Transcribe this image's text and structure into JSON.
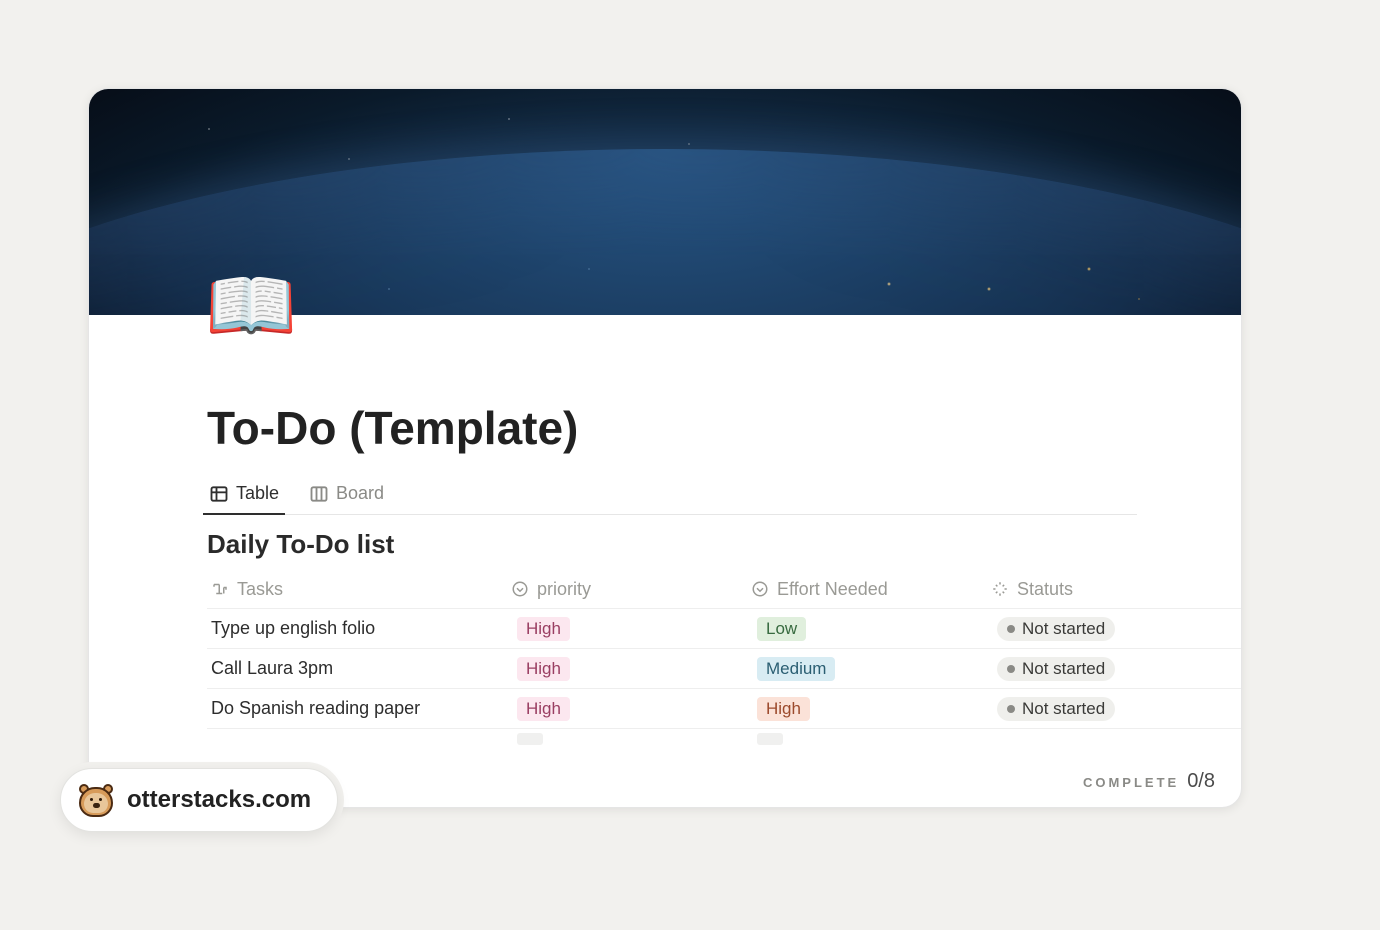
{
  "page": {
    "icon": "📖",
    "title": "To-Do (Template)"
  },
  "tabs": [
    {
      "label": "Table",
      "active": true
    },
    {
      "label": "Board",
      "active": false
    }
  ],
  "database": {
    "title": "Daily To-Do list",
    "columns": [
      {
        "label": "Tasks",
        "icon": "text"
      },
      {
        "label": "priority",
        "icon": "select"
      },
      {
        "label": "Effort Needed",
        "icon": "select"
      },
      {
        "label": "Statuts",
        "icon": "status"
      }
    ],
    "rows": [
      {
        "task": "Type up english folio",
        "priority": "High",
        "effort": "Low",
        "status": "Not started"
      },
      {
        "task": "Call Laura 3pm",
        "priority": "High",
        "effort": "Medium",
        "status": "Not started"
      },
      {
        "task": "Do Spanish reading paper",
        "priority": "High",
        "effort": "High",
        "status": "Not started"
      }
    ]
  },
  "footer": {
    "label": "COMPLETE",
    "count": "0/8"
  },
  "attribution": {
    "text": "otterstacks.com"
  },
  "tag_colors": {
    "priority": {
      "High": "tag-high",
      "Medium": "tag-medium",
      "Low": "tag-low"
    },
    "effort": {
      "High": "tag-effort-high",
      "Medium": "tag-medium",
      "Low": "tag-low"
    }
  }
}
